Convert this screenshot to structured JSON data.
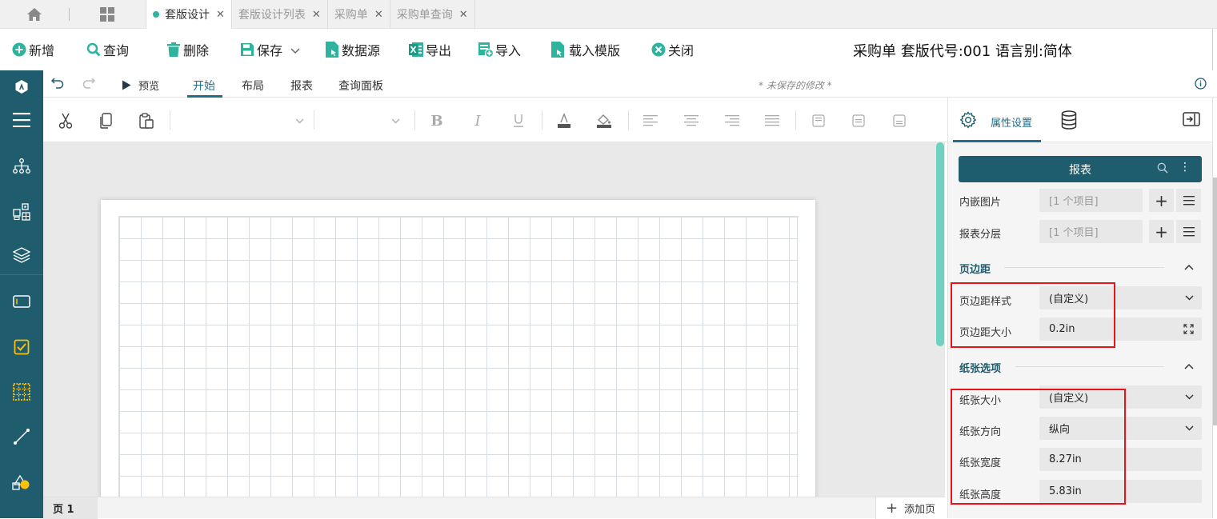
{
  "tabs": [
    {
      "label": "套版设计",
      "active": true
    },
    {
      "label": "套版设计列表",
      "active": false
    },
    {
      "label": "采购单",
      "active": false
    },
    {
      "label": "采购单查询",
      "active": false
    }
  ],
  "toolbar": {
    "new_label": "新增",
    "query_label": "查询",
    "delete_label": "删除",
    "save_label": "保存",
    "datasource_label": "数据源",
    "export_label": "导出",
    "import_label": "导入",
    "load_template_label": "载入模版",
    "close_label": "关闭",
    "doc_title": "采购单 套版代号:001 语言别:简体"
  },
  "designer": {
    "preview_label": "预览",
    "tabs": [
      "开始",
      "布局",
      "报表",
      "查询面板"
    ],
    "active_tab": "开始",
    "unsaved_text": "* 未保存的修改 *"
  },
  "canvas": {
    "page_tab": "页 1",
    "add_page": "添加页"
  },
  "panel": {
    "tab_label": "属性设置",
    "search_title": "报表",
    "rows_top": [
      {
        "label": "内嵌图片",
        "value": "[1 个项目]"
      },
      {
        "label": "报表分层",
        "value": "[1 个项目]"
      }
    ],
    "margin_section": "页边距",
    "margin_style_label": "页边距样式",
    "margin_style_value": "(自定义)",
    "margin_size_label": "页边距大小",
    "margin_size_value": "0.2in",
    "paper_section": "纸张选项",
    "paper_size_label": "纸张大小",
    "paper_size_value": "(自定义)",
    "paper_orient_label": "纸张方向",
    "paper_orient_value": "纵向",
    "paper_width_label": "纸张宽度",
    "paper_width_value": "8.27in",
    "paper_height_label": "纸张高度",
    "paper_height_value": "5.83in"
  },
  "colors": {
    "accent": "#1f6e8c",
    "rail": "#1f5c6e",
    "green": "#2db39e",
    "highlight": "#e8141a"
  }
}
